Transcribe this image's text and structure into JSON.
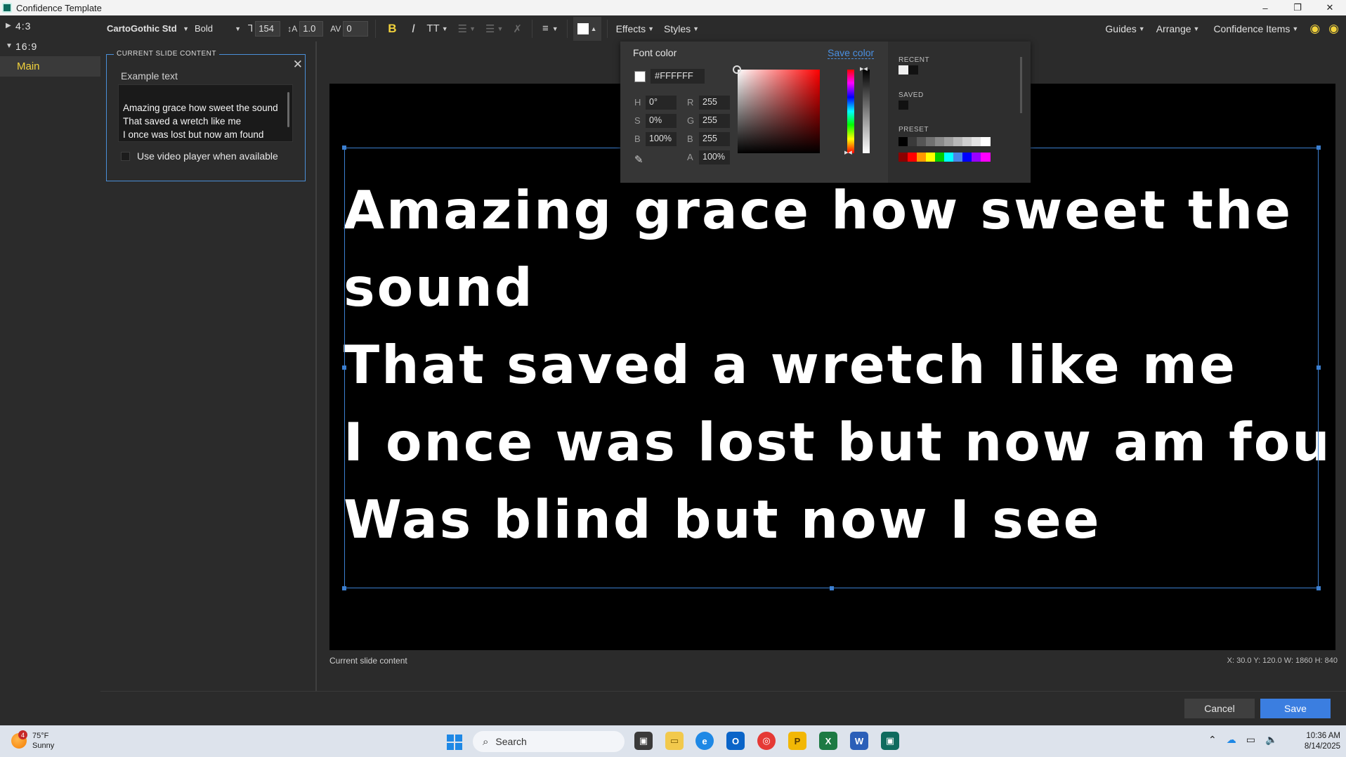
{
  "window": {
    "title": "Confidence Template",
    "minimize": "–",
    "maximize": "❐",
    "close": "✕"
  },
  "tree": {
    "items": [
      {
        "label": "4:3",
        "caret": "▶"
      },
      {
        "label": "16:9",
        "caret": "▼"
      },
      {
        "label": "Main"
      }
    ]
  },
  "toolbar": {
    "font_family": "CartoGothic Std",
    "font_weight": "Bold",
    "font_size": "154",
    "line_spacing": "1.0",
    "char_spacing": "0",
    "bold": "B",
    "italic": "I",
    "text_case": "TT",
    "effects": "Effects",
    "styles": "Styles",
    "guides": "Guides",
    "arrange": "Arrange",
    "confidence_items": "Confidence Items"
  },
  "panel": {
    "section_title": "CURRENT SLIDE CONTENT",
    "example_label": "Example text",
    "lyrics": "Amazing grace how sweet the sound\nThat saved a wretch like me\nI once was lost but now am found\nWas blind but now I see",
    "video_label": "Use video player when available"
  },
  "slide": {
    "lines": [
      "Amazing grace how sweet the",
      "sound",
      "That saved a wretch like me",
      "I once was lost but now am found",
      "Was blind but now I see"
    ],
    "caption": "Current slide content",
    "coords": "X: 30.0  Y: 120.0    W: 1860  H: 840"
  },
  "color_picker": {
    "title": "Font color",
    "save_color": "Save color",
    "hex": "#FFFFFF",
    "h_label": "H",
    "h_value": "0°",
    "s_label": "S",
    "s_value": "0%",
    "b_label": "B",
    "b_value": "100%",
    "r_label": "R",
    "r_value": "255",
    "g_label": "G",
    "g_value": "255",
    "b2_label": "B",
    "b2_value": "255",
    "a_label": "A",
    "a_value": "100%",
    "recent_label": "RECENT",
    "saved_label": "SAVED",
    "preset_label": "PRESET",
    "recent_colors": [
      "#f0f0f0",
      "#111111"
    ],
    "saved_colors": [
      "#111111"
    ],
    "preset_grays": [
      "#000000",
      "#3a3a3a",
      "#555555",
      "#707070",
      "#8a8a8a",
      "#a0a0a0",
      "#b8b8b8",
      "#cfcfcf",
      "#e4e4e4",
      "#ffffff"
    ],
    "preset_colors": [
      "#8b0000",
      "#ff0000",
      "#ff9900",
      "#ffff00",
      "#00cc00",
      "#00ffff",
      "#4a86e8",
      "#0000ff",
      "#9900ff",
      "#ff00ff"
    ]
  },
  "buttons": {
    "cancel": "Cancel",
    "save": "Save"
  },
  "taskbar": {
    "temp": "75°F",
    "condition": "Sunny",
    "badge": "4",
    "search": "Search",
    "time": "10:36 AM",
    "date": "8/14/2025"
  }
}
